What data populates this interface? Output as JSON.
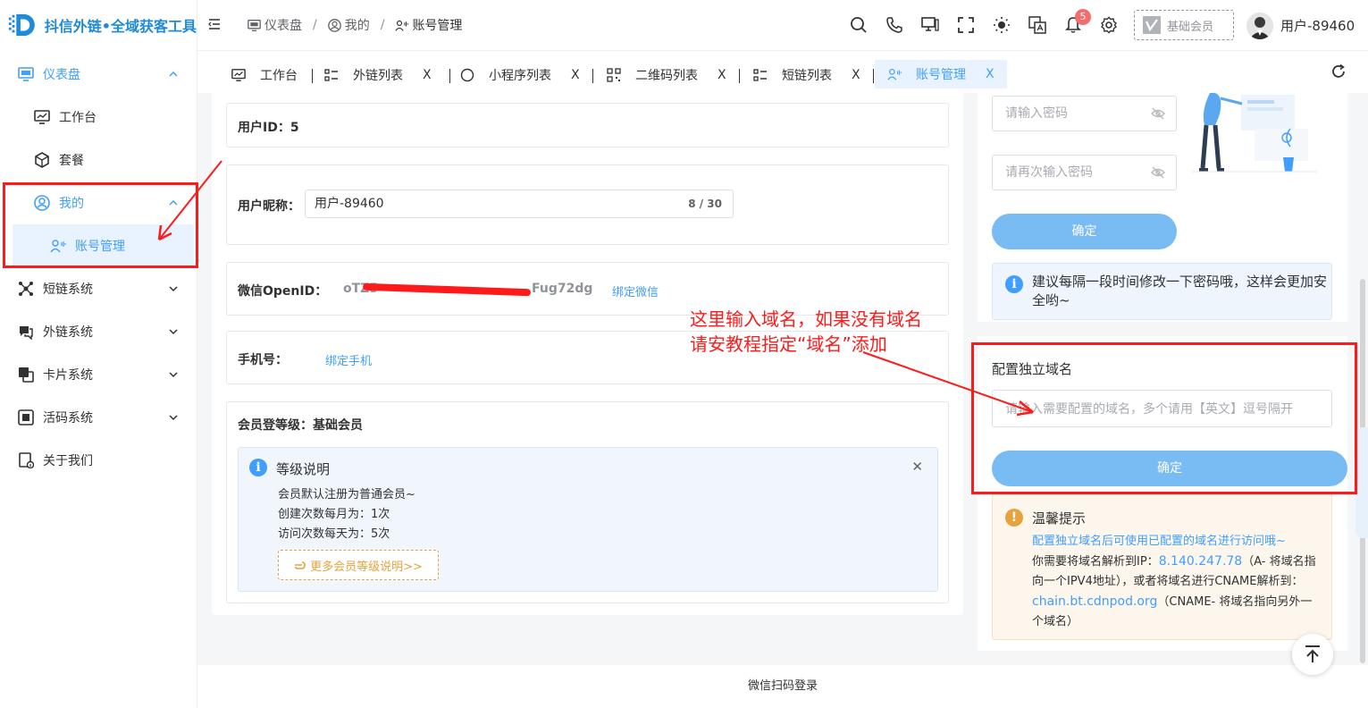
{
  "app": {
    "title": "抖信外链•全域获客工具"
  },
  "sidebar": {
    "items": [
      {
        "label": "仪表盘"
      },
      {
        "label": "工作台"
      },
      {
        "label": "套餐"
      },
      {
        "label": "我的"
      },
      {
        "label": "账号管理"
      },
      {
        "label": "短链系统"
      },
      {
        "label": "外链系统"
      },
      {
        "label": "卡片系统"
      },
      {
        "label": "活码系统"
      },
      {
        "label": "关于我们"
      }
    ]
  },
  "header": {
    "breadcrumb": [
      "仪表盘",
      "我的",
      "账号管理"
    ],
    "notification_count": "5",
    "membership": "基础会员",
    "username": "用户-89460"
  },
  "tabs": [
    {
      "label": "工作台",
      "close": ""
    },
    {
      "label": "外链列表",
      "close": "X"
    },
    {
      "label": "小程序列表",
      "close": "X"
    },
    {
      "label": "二维码列表",
      "close": "X"
    },
    {
      "label": "短链列表",
      "close": "X"
    },
    {
      "label": "账号管理",
      "close": "X"
    }
  ],
  "profile": {
    "user_id_label": "用户ID：",
    "user_id": "5",
    "nickname_label": "用户昵称：",
    "nickname": "用户-89460",
    "nickname_counter": "8 / 30",
    "openid_label": "微信OpenID：",
    "openid_prefix": "oTZ5",
    "openid_suffix": "Fug72dg",
    "bind_wechat": "绑定微信",
    "phone_label": "手机号：",
    "bind_phone": "绑定手机",
    "level_label": "会员登等级：",
    "level": "基础会员",
    "level_info": {
      "title": "等级说明",
      "lines": [
        "会员默认注册为普通会员~",
        "创建次数每月为：1次",
        "访问次数每天为：5次"
      ],
      "more": "更多会员等级说明>>",
      "close": "✕"
    }
  },
  "password": {
    "placeholder1": "请输入密码",
    "placeholder2": "请再次输入密码",
    "confirm": "确定",
    "tip": "建议每隔一段时间修改一下密码哦，这样会更加安全哟~"
  },
  "domain": {
    "title": "配置独立域名",
    "placeholder": "请输入需要配置的域名，多个请用【英文】逗号隔开",
    "confirm": "确定",
    "warn_title": "温馨提示",
    "warn_link": "配置独立域名后可使用已配置的域名进行访问哦~",
    "warn_text1": "你需要将域名解析到IP：",
    "ip": "8.140.247.78",
    "warn_text2": "（A- 将域名指向一个IPV4地址），或者将域名进行CNAME解析到：",
    "cname": "chain.bt.cdnpod.org",
    "warn_text3": "（CNAME- 将域名指向另外一个域名）"
  },
  "annotation": {
    "line1": "这里输入域名，如果没有域名",
    "line2": "请安教程指定“域名”添加"
  },
  "footer": {
    "text": "微信扫码登录"
  },
  "colors": {
    "primary": "#409eff",
    "annotation": "#ff1a1a",
    "warning": "#e6a23c"
  }
}
